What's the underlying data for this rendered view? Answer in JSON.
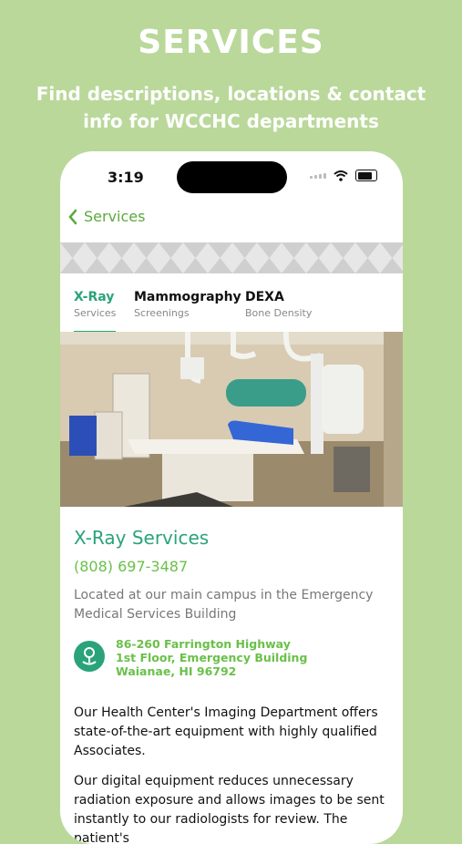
{
  "header": {
    "title": "SERVICES",
    "subtitle": "Find descriptions, locations & contact info for WCCHC departments"
  },
  "status_bar": {
    "time": "3:19"
  },
  "nav": {
    "back_label": "Services"
  },
  "tabs": [
    {
      "label": "X-Ray",
      "sub": "Services",
      "active": true
    },
    {
      "label": "Mammography",
      "sub": "Screenings",
      "active": false
    },
    {
      "label": "DEXA",
      "sub": "Bone Density",
      "active": false
    }
  ],
  "service": {
    "title": "X-Ray Services",
    "phone": "(808) 697-3487",
    "location": "Located at our main campus in the Emergency Medical Services Building",
    "address": [
      "86-260 Farrington Highway",
      "1st Floor, Emergency Building",
      "Waianae, HI 96792"
    ],
    "description": [
      "Our Health Center's Imaging Department offers state-of-the-art equipment with highly qualified Associates.",
      "Our digital equipment reduces unnecessary radiation exposure and allows images to be sent instantly to our radiologists for review. The patient's"
    ]
  },
  "icons": {
    "back": "chevron-left-icon",
    "address": "map-pin-icon",
    "wifi": "wifi-icon",
    "battery": "battery-icon"
  },
  "colors": {
    "background": "#b9d89a",
    "accent": "#2aa37a",
    "link": "#5aaa3c"
  }
}
